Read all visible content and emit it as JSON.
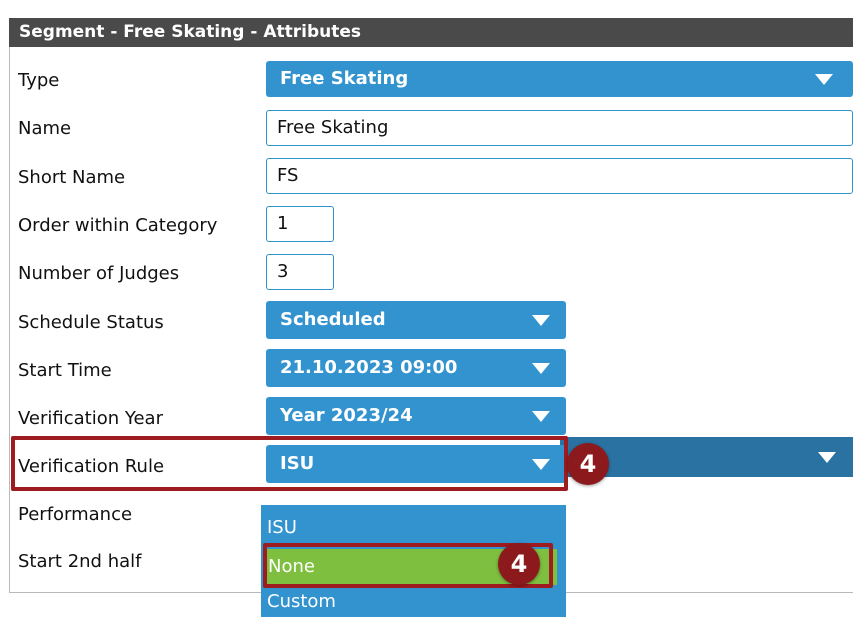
{
  "header": {
    "title": "Segment - Free Skating - Attributes"
  },
  "fields": {
    "type": {
      "label": "Type",
      "value": "Free Skating"
    },
    "name": {
      "label": "Name",
      "value": "Free Skating"
    },
    "short_name": {
      "label": "Short Name",
      "value": "FS"
    },
    "order_within_category": {
      "label": "Order within Category",
      "value": "1"
    },
    "number_of_judges": {
      "label": "Number of Judges",
      "value": "3"
    },
    "schedule_status": {
      "label": "Schedule Status",
      "value": "Scheduled"
    },
    "start_time": {
      "label": "Start Time",
      "value": "21.10.2023 09:00"
    },
    "verification_year": {
      "label": "Verification Year",
      "value": "Year 2023/24"
    },
    "verification_rule": {
      "label": "Verification Rule",
      "value": "ISU"
    },
    "performance": {
      "label": "Performance"
    },
    "start_2nd_half": {
      "label": "Start 2nd half"
    }
  },
  "dropdown": {
    "options": [
      "ISU",
      "None",
      "Custom"
    ],
    "selected_index": 1
  },
  "annotations": {
    "step_badge_1": "4",
    "step_badge_2": "4"
  },
  "colors": {
    "header_bg": "#4a4a4a",
    "select_blue": "#3393cf",
    "dark_blue": "#2a72a2",
    "highlight_red": "#9e1b1f",
    "option_selected_green": "#7fbf3f"
  }
}
